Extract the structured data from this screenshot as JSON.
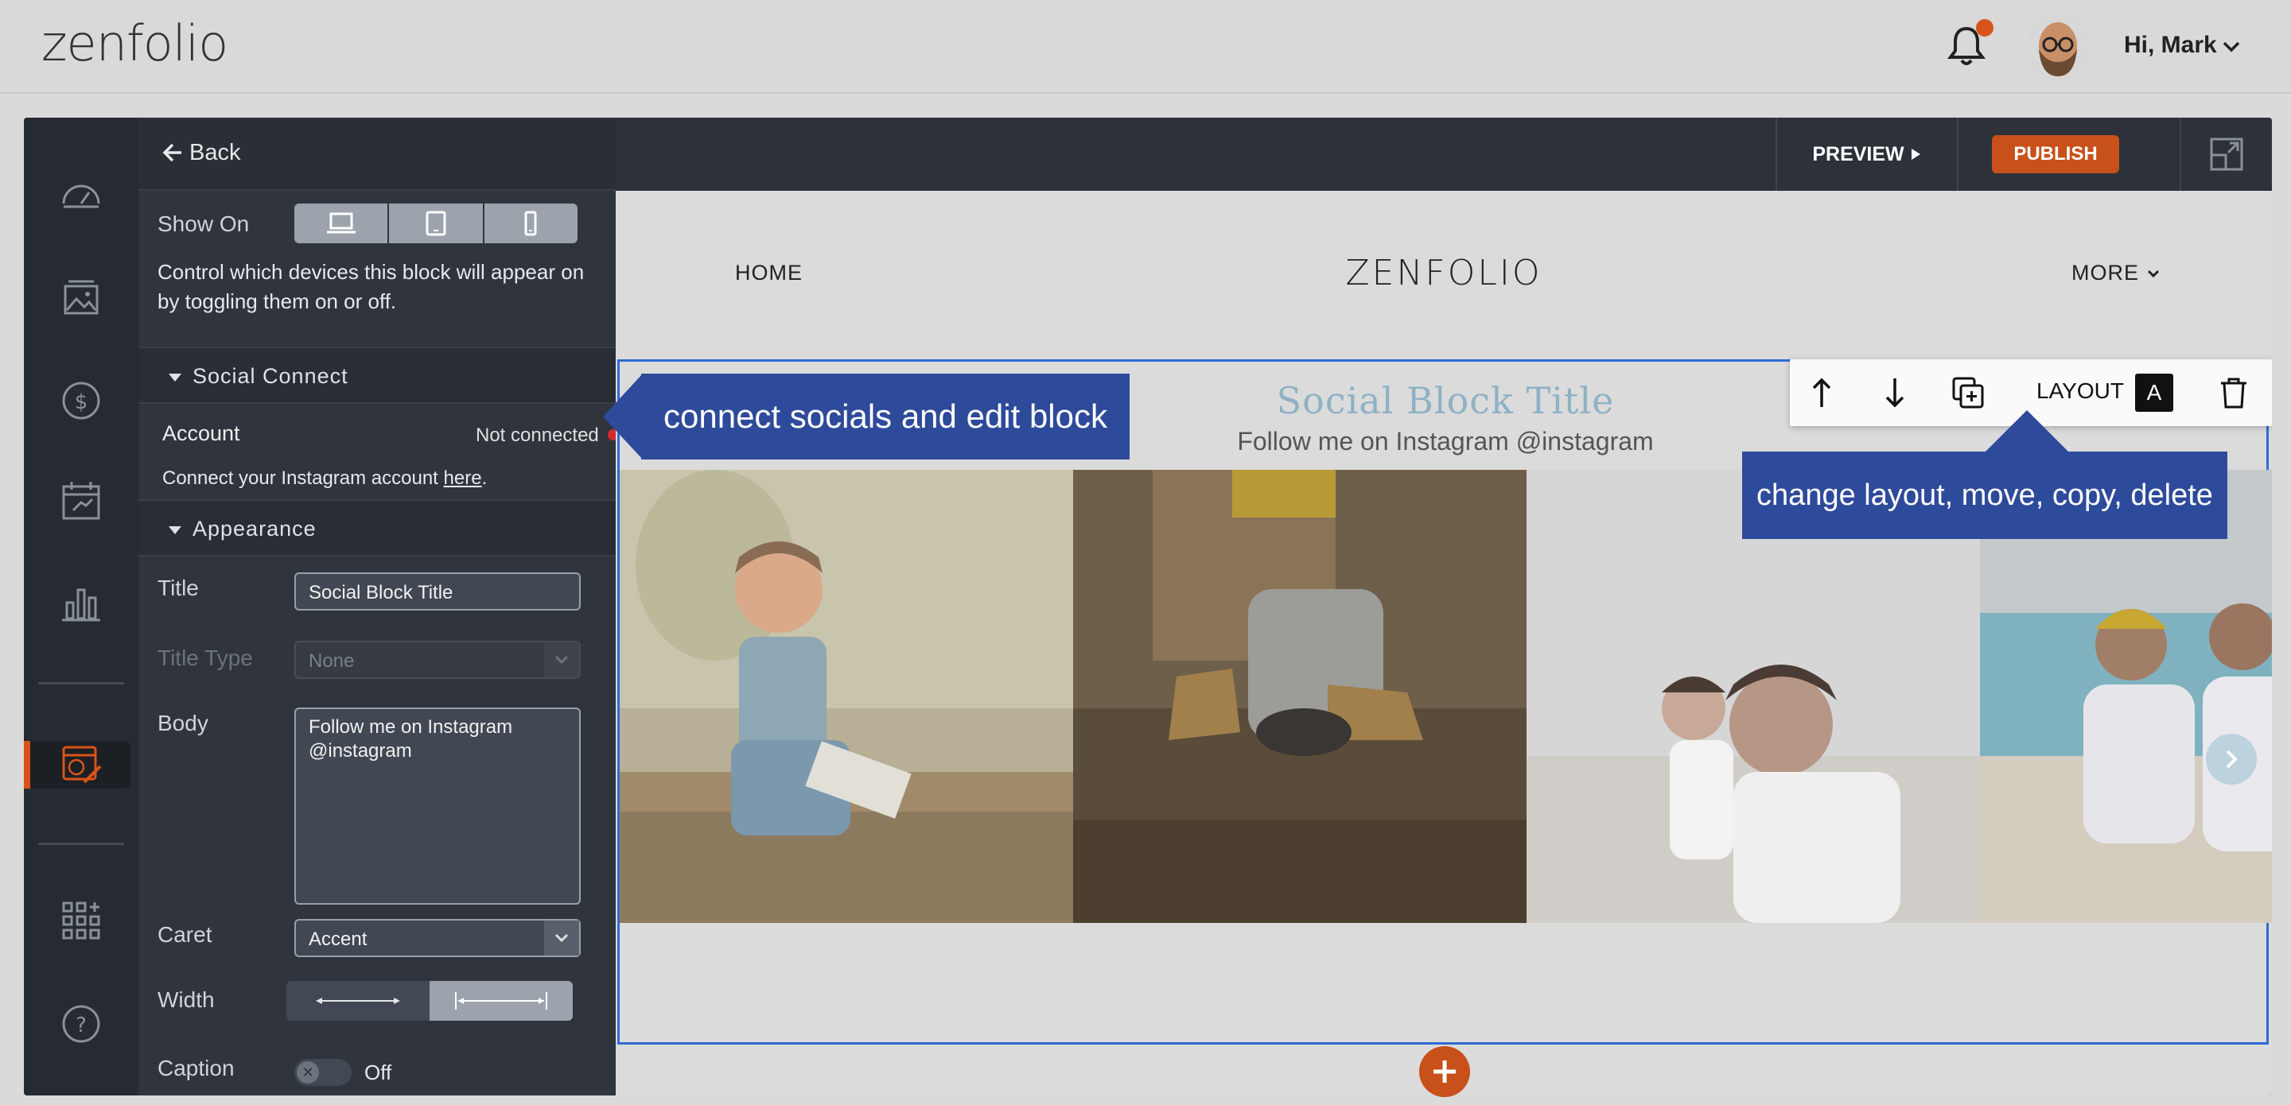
{
  "header": {
    "logo": "zenfolio",
    "greeting": "Hi, Mark",
    "notification_dot_color": "#d9541a"
  },
  "rail": {
    "icons": [
      "dashboard-icon",
      "gallery-icon",
      "sales-icon",
      "calendar-icon",
      "stats-icon",
      "website-editor-icon",
      "apps-icon",
      "help-icon"
    ],
    "active": "website-editor-icon"
  },
  "panel": {
    "back_label": "Back",
    "show_on_label": "Show On",
    "show_on_devices": [
      "desktop-icon",
      "tablet-icon",
      "mobile-icon"
    ],
    "show_on_desc": "Control which devices this block will appear on by toggling them on or off.",
    "social_section": "Social Connect",
    "account_label": "Account",
    "account_status": "Not connected",
    "account_help_prefix": "Connect your Instagram account ",
    "account_help_link": "here",
    "account_help_suffix": ".",
    "appearance_section": "Appearance",
    "title_label": "Title",
    "title_value": "Social Block Title",
    "title_type_label": "Title Type",
    "title_type_value": "None",
    "body_label": "Body",
    "body_value": "Follow me on Instagram @instagram",
    "caret_label": "Caret",
    "caret_value": "Accent",
    "width_label": "Width",
    "width_selected": "full",
    "caption_label": "Caption",
    "caption_value": "Off"
  },
  "canvas": {
    "preview_label": "PREVIEW",
    "publish_label": "PUBLISH",
    "publish_color": "#c8501a",
    "nav_home": "HOME",
    "nav_brand": "ZENFOLIO",
    "nav_more": "MORE",
    "block_title": "Social Block Title",
    "block_body": "Follow me on Instagram @instagram",
    "toolbar_layout_label": "LAYOUT",
    "toolbar_layout_value": "A"
  },
  "callouts": {
    "left": "connect socials and edit block",
    "right": "change layout, move, copy, delete"
  }
}
